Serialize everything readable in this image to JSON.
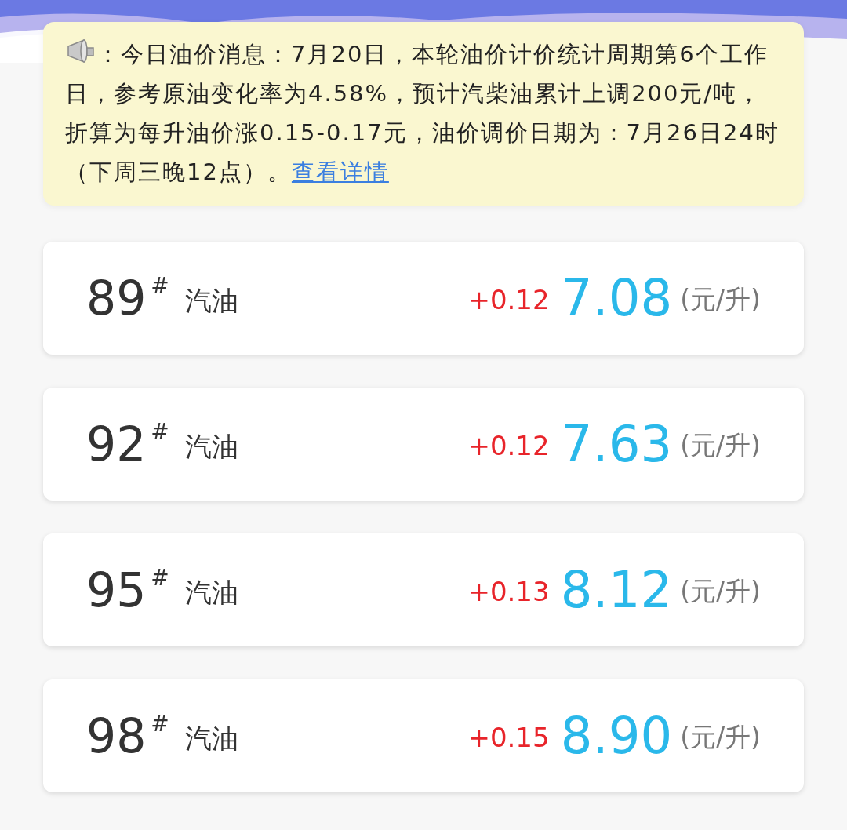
{
  "notice": {
    "text": "：今日油价消息：7月20日，本轮油价计价统计周期第6个工作日，参考原油变化率为4.58%，预计汽柴油累计上调200元/吨，折算为每升油价涨0.15-0.17元，油价调价日期为：7月26日24时（下周三晚12点）。",
    "link": "查看详情"
  },
  "fuels": [
    {
      "grade": "89",
      "mark": "#",
      "name": "汽油",
      "change": "+0.12",
      "price": "7.08",
      "unit": "(元/升)"
    },
    {
      "grade": "92",
      "mark": "#",
      "name": "汽油",
      "change": "+0.12",
      "price": "7.63",
      "unit": "(元/升)"
    },
    {
      "grade": "95",
      "mark": "#",
      "name": "汽油",
      "change": "+0.13",
      "price": "8.12",
      "unit": "(元/升)"
    },
    {
      "grade": "98",
      "mark": "#",
      "name": "汽油",
      "change": "+0.15",
      "price": "8.90",
      "unit": "(元/升)"
    }
  ]
}
